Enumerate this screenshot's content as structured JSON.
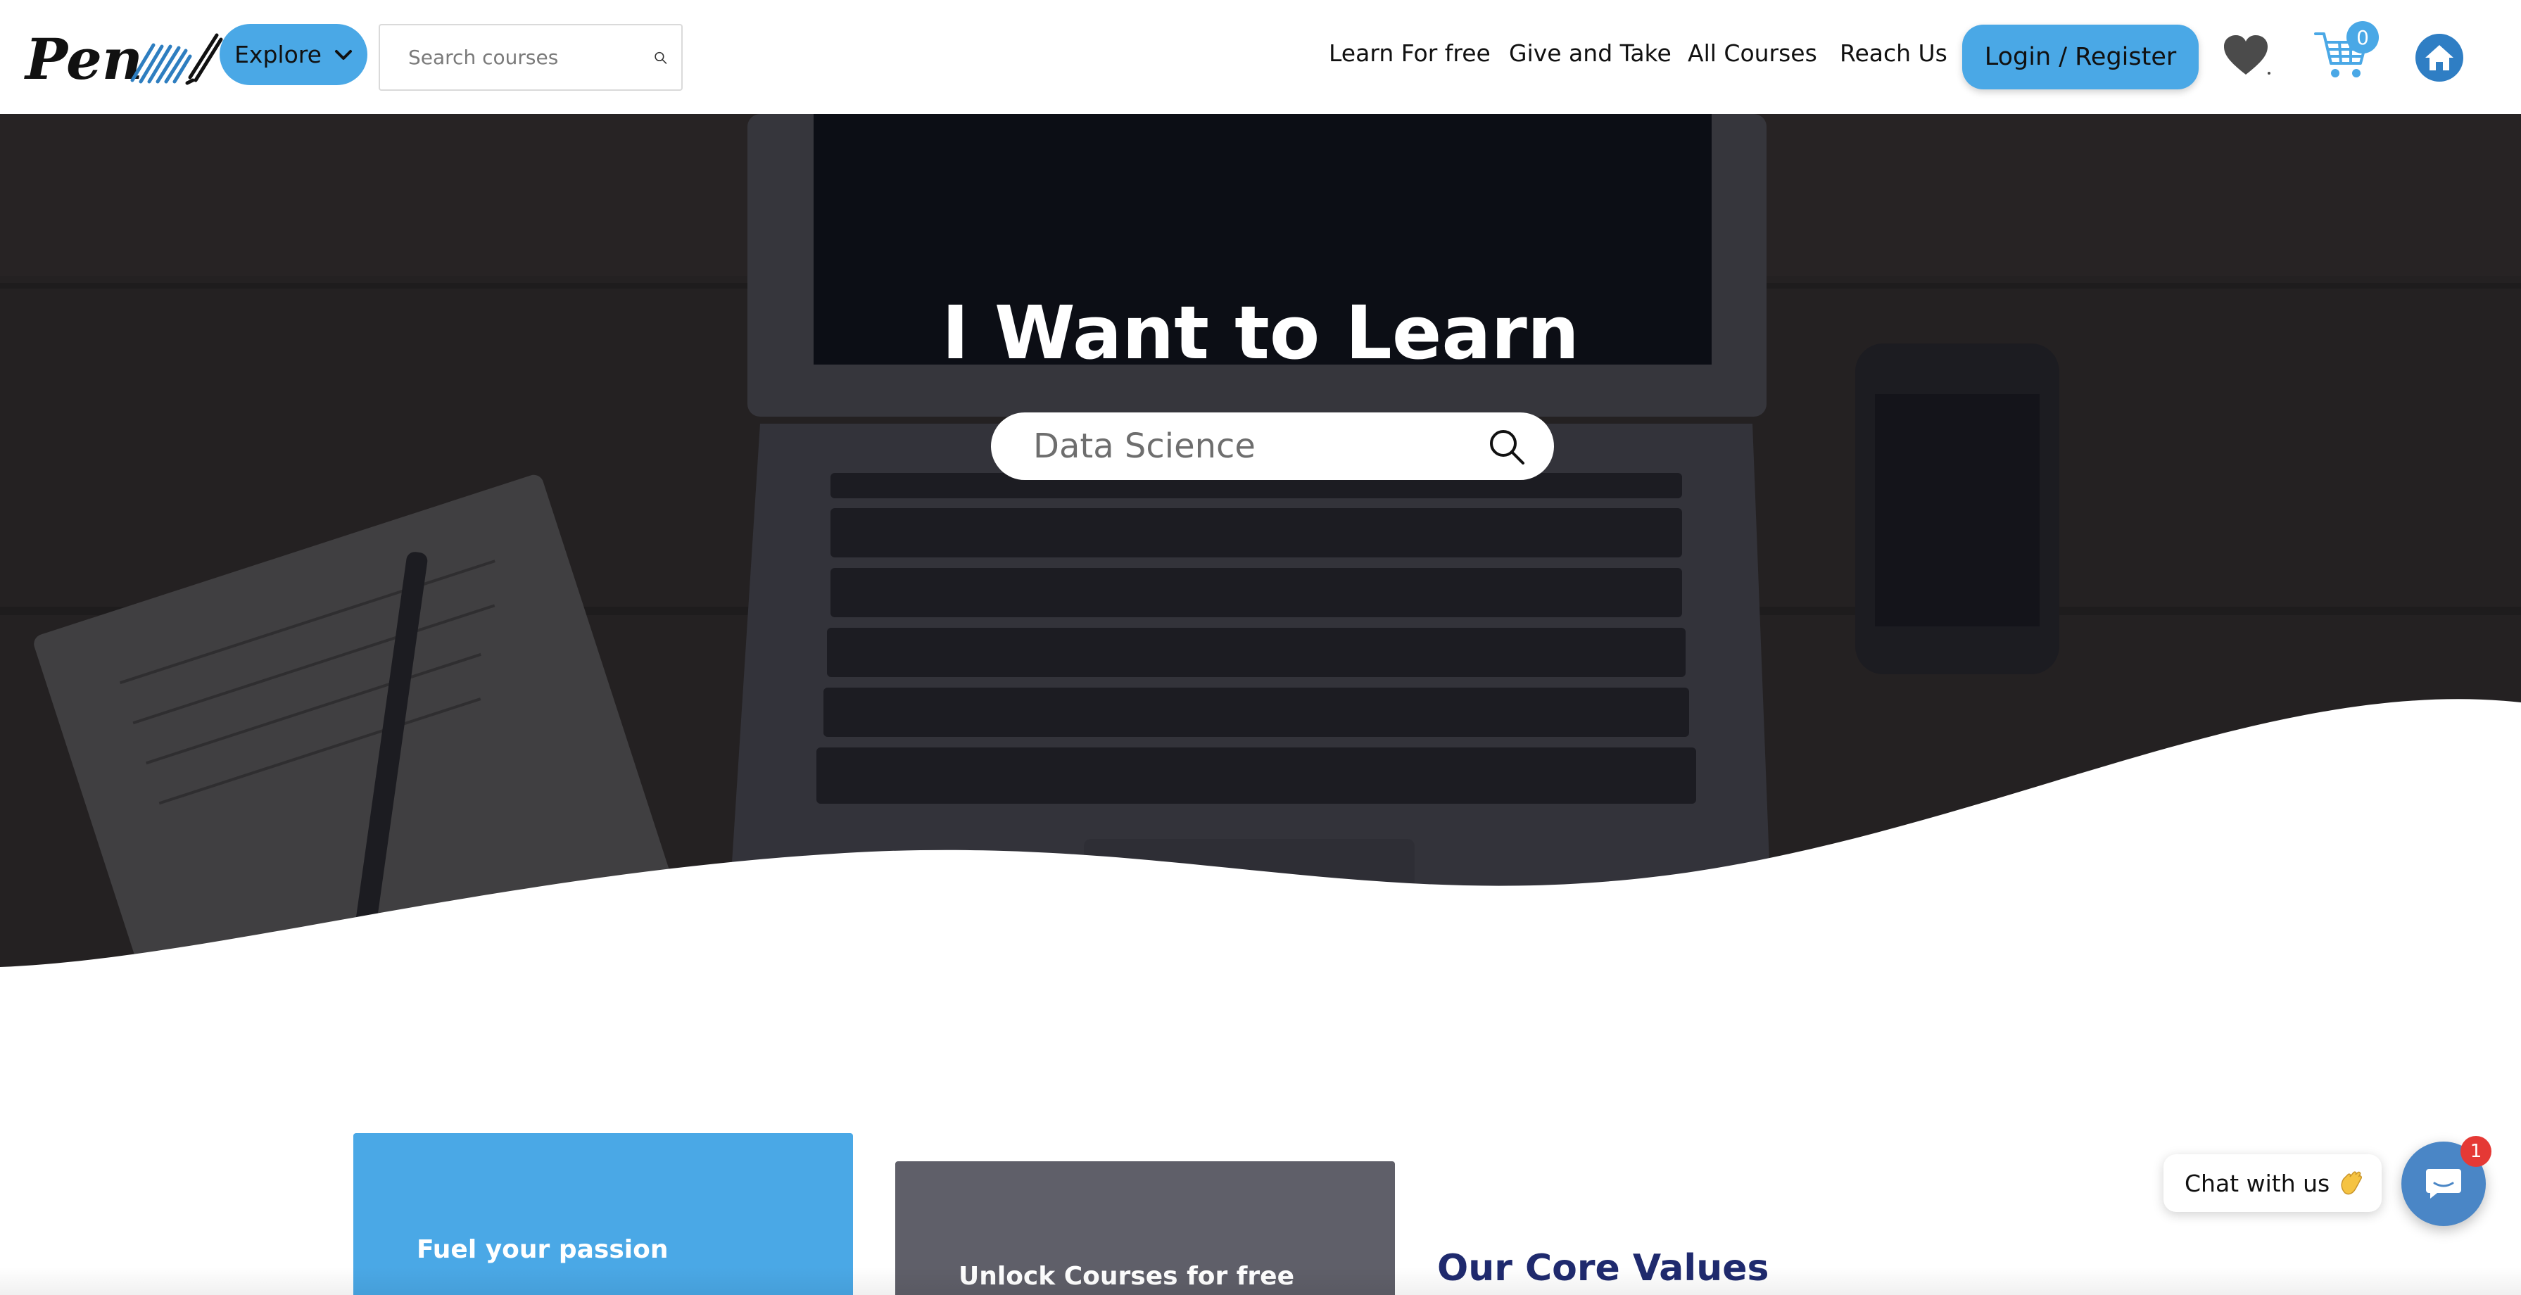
{
  "header": {
    "logo_text": "Pen",
    "explore_label": "Explore",
    "search_placeholder": "Search courses",
    "nav": [
      "Learn For free",
      "Give and Take",
      "All Courses",
      "Reach Us"
    ],
    "login_label": "Login / Register",
    "cart_count": "0"
  },
  "hero": {
    "title": "I Want to Learn",
    "search_value": "Data Science"
  },
  "cards": {
    "card1_label": "Fuel your passion",
    "card2_label": "Unlock Courses for free"
  },
  "section": {
    "core_values_title": "Our Core Values"
  },
  "chat": {
    "label": "Chat with us",
    "badge_count": "1"
  },
  "colors": {
    "accent": "#4aa8e6",
    "card_grey": "#5f5f69",
    "heading_navy": "#1f2a6e",
    "chat_blue": "#4a86c6",
    "badge_red": "#e53935"
  },
  "icons": [
    "logo-pen-icon",
    "chevron-down-icon",
    "search-icon",
    "heart-icon",
    "cart-icon",
    "home-icon",
    "chat-icon",
    "wave-hand-icon"
  ]
}
